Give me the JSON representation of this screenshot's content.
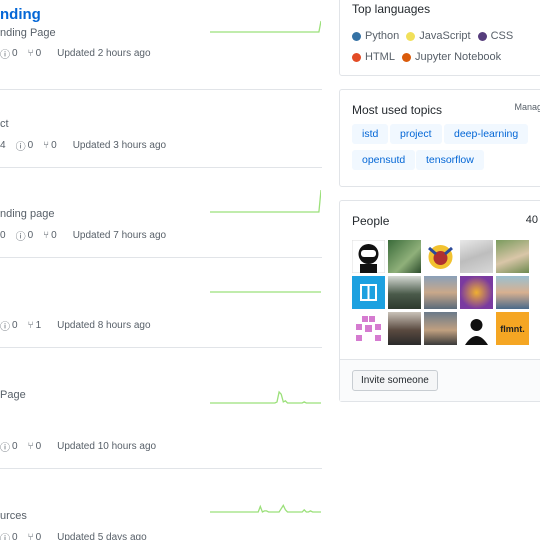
{
  "repos": [
    {
      "name": "nding",
      "description": "nding Page",
      "issues": "0",
      "prs": "0",
      "forks": "",
      "updated": "Updated 2 hours ago",
      "activity": [
        0,
        0,
        0,
        0,
        0,
        0,
        0,
        0,
        0,
        0,
        0,
        0,
        0,
        0,
        0,
        0,
        0,
        0,
        0,
        0,
        0,
        0,
        0,
        0,
        0,
        0,
        0,
        0,
        0,
        0,
        0,
        0,
        0,
        0,
        0,
        0,
        0,
        0,
        0,
        0,
        0,
        0,
        0,
        0,
        0,
        0,
        0,
        0,
        0,
        0,
        0,
        0,
        0,
        0.5
      ]
    },
    {
      "name": "",
      "description": "ct",
      "issues": "0",
      "prs": "0",
      "forks": "4",
      "updated": "Updated 3 hours ago",
      "activity": []
    },
    {
      "name": "",
      "description": "nding page",
      "issues": "0",
      "prs": "0",
      "forks": "0",
      "updated": "Updated 7 hours ago",
      "activity": [
        0,
        0,
        0,
        0,
        0,
        0,
        0,
        0,
        0,
        0,
        0,
        0,
        0,
        0,
        0,
        0,
        0,
        0,
        0,
        0,
        0,
        0,
        0,
        0,
        0,
        0,
        0,
        0,
        0,
        0,
        0,
        0,
        0,
        0,
        0,
        0,
        0,
        0,
        0,
        0,
        0,
        0,
        0,
        0,
        0,
        0,
        0,
        0,
        0,
        0,
        0,
        0,
        0,
        1
      ]
    },
    {
      "name": "",
      "description": "",
      "issues": "0",
      "prs": "1",
      "forks": "",
      "updated": "Updated 8 hours ago",
      "activity": [
        0,
        0,
        0,
        0,
        0,
        0,
        0,
        0,
        0,
        0,
        0,
        0,
        0,
        0,
        0,
        0,
        0,
        0,
        0,
        0,
        0,
        0,
        0,
        0,
        0,
        0,
        0,
        0,
        0,
        0,
        0,
        0,
        0,
        0,
        0,
        0,
        0,
        0,
        0,
        0,
        0,
        0,
        0,
        0,
        0,
        0,
        0,
        0,
        0,
        0,
        0,
        0,
        0,
        0
      ]
    },
    {
      "name": "",
      "description": "Page",
      "issues": "0",
      "prs": "0",
      "forks": "",
      "updated": "Updated 10 hours ago",
      "activity": [
        0,
        0,
        0,
        0,
        0,
        0,
        0,
        0,
        0,
        0,
        0,
        0,
        0,
        0,
        0,
        0,
        0,
        0,
        0,
        0,
        0,
        0,
        0,
        0,
        0,
        0,
        0,
        0,
        0,
        0,
        0,
        0,
        0.05,
        0.5,
        0.4,
        0.05,
        0.1,
        0,
        0,
        0,
        0,
        0,
        0,
        0,
        0,
        0.05,
        0,
        0,
        0,
        0,
        0,
        0,
        0,
        0
      ]
    },
    {
      "name": "",
      "description": "urces",
      "issues": "0",
      "prs": "0",
      "forks": "",
      "updated": "Updated 5 days ago",
      "activity": [
        0,
        0,
        0,
        0,
        0,
        0,
        0,
        0,
        0,
        0,
        0,
        0,
        0,
        0,
        0,
        0,
        0,
        0,
        0,
        0,
        0,
        0,
        0,
        0,
        0.25,
        0,
        0.05,
        0.05,
        0,
        0,
        0,
        0,
        0,
        0,
        0.15,
        0.3,
        0.1,
        0,
        0,
        0,
        0,
        0,
        0,
        0,
        0,
        0.1,
        0,
        0,
        0.05,
        0,
        0,
        0,
        0,
        0
      ]
    }
  ],
  "sidebar": {
    "languages": {
      "title": "Top languages",
      "items": [
        {
          "name": "Python",
          "color": "#3572A5"
        },
        {
          "name": "JavaScript",
          "color": "#f1e05a"
        },
        {
          "name": "CSS",
          "color": "#563d7c"
        },
        {
          "name": "HTML",
          "color": "#e34c26"
        },
        {
          "name": "Jupyter Notebook",
          "color": "#DA5B0B"
        }
      ]
    },
    "topics": {
      "title": "Most used topics",
      "manage": "Manag",
      "items": [
        "istd",
        "project",
        "deep-learning",
        "opensutd",
        "tensorflow"
      ]
    },
    "people": {
      "title": "People",
      "count": "40",
      "avatars": [
        "robot-avatar",
        "group-photo-avatar",
        "cartoon-avatar",
        "sketch-avatar",
        "outdoor-avatar",
        "blue-logo-avatar",
        "portrait-avatar",
        "blurry-avatar",
        "colorful-avatar",
        "smiling-avatar",
        "identicon-avatar",
        "person-avatar",
        "glasses-avatar",
        "silhouette-avatar",
        "flmnt-avatar"
      ],
      "flmnt_label": "flmnt.",
      "invite_label": "Invite someone"
    }
  }
}
